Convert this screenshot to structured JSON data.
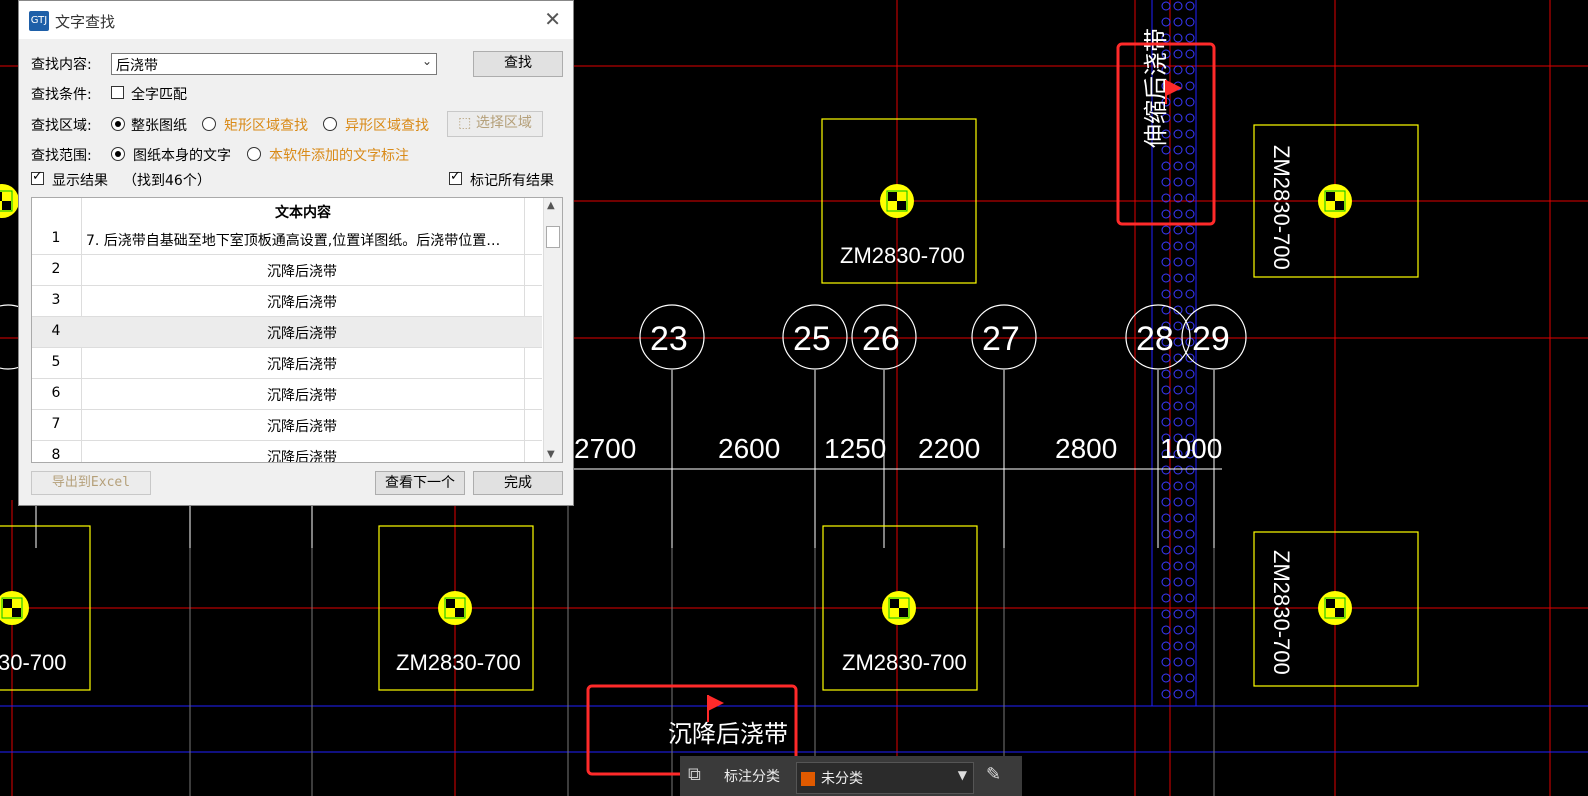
{
  "dialog": {
    "title": "文字查找",
    "app_icon_text": "GTJ",
    "close_glyph": "✕",
    "search_content_label": "查找内容:",
    "search_value": "后浇带",
    "find_button": "查找",
    "condition_label": "查找条件:",
    "whole_word_label": "全字匹配",
    "region_label": "查找区域:",
    "region_options": [
      "整张图纸",
      "矩形区域查找",
      "异形区域查找"
    ],
    "select_region_button": "选择区域",
    "scope_label": "查找范围:",
    "scope_options": [
      "图纸本身的文字",
      "本软件添加的文字标注"
    ],
    "show_results_label": "显示结果",
    "found_count": "（找到46个）",
    "mark_all_label": "标记所有结果",
    "table_header": "文本内容",
    "rows": [
      {
        "n": "1",
        "text": "7.  后浇带自基础至地下室顶板通高设置,位置详图纸。后浇带位置…"
      },
      {
        "n": "2",
        "text": "沉降后浇带"
      },
      {
        "n": "3",
        "text": "沉降后浇带"
      },
      {
        "n": "4",
        "text": "沉降后浇带"
      },
      {
        "n": "5",
        "text": "沉降后浇带"
      },
      {
        "n": "6",
        "text": "沉降后浇带"
      },
      {
        "n": "7",
        "text": "沉降后浇带"
      },
      {
        "n": "8",
        "text": "沉降后浇带"
      }
    ],
    "export_button": "导出到Excel",
    "next_button": "查看下一个",
    "done_button": "完成"
  },
  "cad": {
    "axis_labels": [
      "23",
      "25",
      "26",
      "27",
      "28",
      "29"
    ],
    "dimensions": [
      "2700",
      "2600",
      "1250",
      "2200",
      "2800",
      "1000",
      "00"
    ],
    "column_tags": [
      "ZM2830-700",
      "ZM2830-700",
      "ZM2830-700",
      "ZM2830-700",
      "30-700",
      "ZM2830-700",
      "ZM2830-700"
    ],
    "band_text_bottom": "沉降后浇带",
    "band_text_vertical": "伸缩后浇带",
    "partial_dim_left": "30",
    "colors": {
      "grid": "#ff0000",
      "column": "#ffff00",
      "band": "#0000ff",
      "highlight": "#ff2a2a"
    }
  },
  "toolbar": {
    "label": "标注分类",
    "select_value": "未分类"
  }
}
